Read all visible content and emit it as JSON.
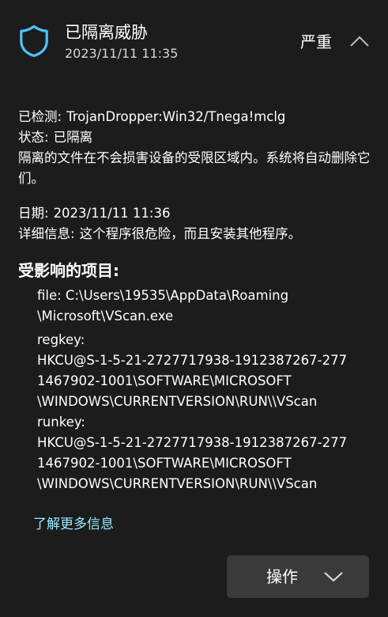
{
  "header": {
    "icon": "shield-icon",
    "title": "已隔离威胁",
    "timestamp": "2023/11/11 11:35",
    "severity": "严重",
    "collapse_icon": "chevron-up-icon"
  },
  "details": {
    "detected_label": "已检测:",
    "detected_value": "TrojanDropper:Win32/Tnega!mclg",
    "status_label": "状态:",
    "status_value": "已隔离",
    "description": "隔离的文件在不会损害设备的受限区域内。系统将自动删除它们。",
    "date_label": "日期:",
    "date_value": "2023/11/11 11:36",
    "details_label": "详细信息:",
    "details_value": "这个程序很危险，而且安装其他程序。"
  },
  "affected": {
    "title": "受影响的项目:",
    "lines": [
      "file: C:\\Users\\19535\\AppData\\Roaming",
      "\\Microsoft\\VScan.exe",
      "regkey:",
      "HKCU@S-1-5-21-2727717938-1912387267-277",
      "1467902-1001\\SOFTWARE\\MICROSOFT",
      "\\WINDOWS\\CURRENTVERSION\\RUN\\\\VScan",
      "runkey:",
      "HKCU@S-1-5-21-2727717938-1912387267-277",
      "1467902-1001\\SOFTWARE\\MICROSOFT",
      "\\WINDOWS\\CURRENTVERSION\\RUN\\\\VScan"
    ]
  },
  "footer": {
    "learn_more": "了解更多信息",
    "actions_label": "操作",
    "actions_icon": "chevron-down-icon"
  },
  "colors": {
    "background": "#1c1c1c",
    "shield": "#4cc2ff",
    "link": "#99ebff",
    "button": "#3a3a3a"
  }
}
